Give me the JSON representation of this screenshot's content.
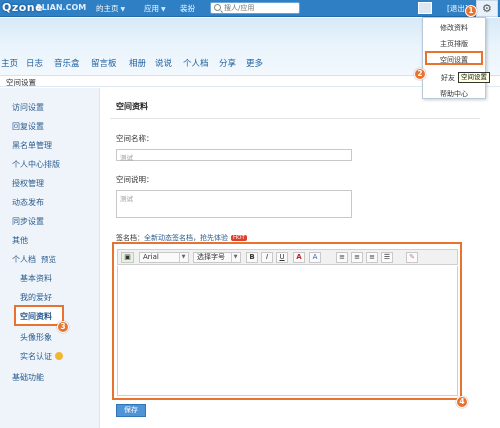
{
  "topbar": {
    "logo": "Qzone",
    "logo_url": "3LIAN.COM",
    "menu": [
      {
        "label": "的主页"
      },
      {
        "label": "应用"
      },
      {
        "label": "装扮"
      }
    ],
    "search_placeholder": "搜人/应用",
    "logout": "[退出]"
  },
  "nav": [
    "主页",
    "日志",
    "音乐盒",
    "留言板",
    "相册",
    "说说",
    "个人档",
    "分享",
    "更多"
  ],
  "breadcrumb": "空间设置",
  "sidebar": {
    "items": [
      "访问设置",
      "回复设置",
      "黑名单管理",
      "个人中心排版",
      "授权管理",
      "动态发布",
      "同步设置",
      "其他"
    ],
    "profile": "个人档",
    "profile_hint": "预览",
    "sub_items": [
      "基本资料",
      "我的爱好",
      "空间资料",
      "头像形象",
      "实名认证"
    ],
    "basic_functions": "基础功能"
  },
  "main": {
    "title": "空间资料",
    "space_name_label": "空间名称：",
    "space_name_value": "测试",
    "space_desc_label": "空间说明：",
    "space_desc_value": "测试",
    "signature_prefix": "签名档：",
    "signature_link": "全新动态签名档，抢先体验",
    "hot_badge": "HOT",
    "save_button": "保存"
  },
  "editor": {
    "font": "Arial",
    "font_size": "选择字号",
    "bold": "B",
    "italic": "I",
    "underline": "U",
    "text_color": "A",
    "highlight": "A"
  },
  "dropdown": [
    "修改资料",
    "主页排版",
    "空间设置",
    "好友",
    "帮助中心"
  ],
  "tooltip": "空间设置",
  "markers": [
    "1",
    "2",
    "3",
    "4"
  ],
  "colors": {
    "topbar": "#2f7fc4",
    "accent": "#e8732f",
    "link": "#2a5b8e"
  }
}
